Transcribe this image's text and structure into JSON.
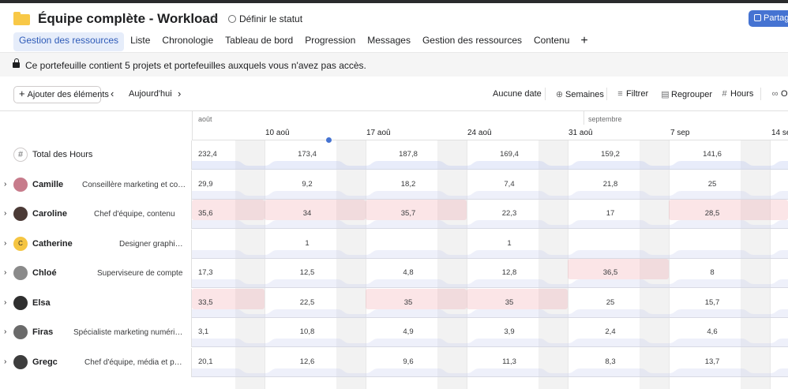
{
  "header": {
    "title": "Équipe complète - Workload",
    "status_label": "Définir le statut",
    "share_label": "Partage"
  },
  "tabs": [
    {
      "label": "Gestion des ressources",
      "active": true
    },
    {
      "label": "Liste"
    },
    {
      "label": "Chronologie"
    },
    {
      "label": "Tableau de bord"
    },
    {
      "label": "Progression"
    },
    {
      "label": "Messages"
    },
    {
      "label": "Gestion des ressources"
    },
    {
      "label": "Contenu"
    }
  ],
  "banner": {
    "text": "Ce portefeuille contient 5 projets et portefeuilles auxquels vous n'avez pas accès."
  },
  "toolbar": {
    "add_label": "Ajouter des éléments",
    "today_label": "Aujourd'hui",
    "no_date_label": "Aucune date",
    "weeks_label": "Semaines",
    "filter_label": "Filtrer",
    "group_label": "Regrouper",
    "hours_label": "Hours",
    "options_label": "Op"
  },
  "timeline": {
    "months": [
      "août",
      "septembre"
    ],
    "weeks": [
      "10 aoû",
      "17 aoû",
      "24 aoû",
      "31 aoû",
      "7 sep",
      "14 se"
    ]
  },
  "total": {
    "label": "Total des Hours",
    "values": [
      "232,4",
      "173,4",
      "187,8",
      "169,4",
      "159,2",
      "141,6"
    ]
  },
  "people": [
    {
      "name": "Camille",
      "role": "Conseillère marketing et com...",
      "values": [
        "29,9",
        "9,2",
        "18,2",
        "7,4",
        "21,8",
        "25"
      ],
      "over": [],
      "avatar_color": "#c77b8b"
    },
    {
      "name": "Caroline",
      "role": "Chef d'équipe, contenu",
      "values": [
        "35,6",
        "34",
        "35,7",
        "22,3",
        "17",
        "28,5"
      ],
      "over": [
        0,
        1,
        2,
        5
      ],
      "avatar_color": "#4b3a36"
    },
    {
      "name": "Catherine",
      "role": "Designer graphiqu...",
      "values": [
        "",
        "1",
        "",
        "1",
        "",
        ""
      ],
      "over": [],
      "avatar_color": "#f5c542",
      "initials": "C"
    },
    {
      "name": "Chloé",
      "role": "Superviseure de compte",
      "values": [
        "17,3",
        "12,5",
        "4,8",
        "12,8",
        "36,5",
        "8"
      ],
      "over": [
        4
      ],
      "avatar_color": "#8a8a8a"
    },
    {
      "name": "Elsa",
      "role": "",
      "values": [
        "33,5",
        "22,5",
        "35",
        "35",
        "25",
        "15,7"
      ],
      "over": [
        0,
        2,
        3
      ],
      "avatar_color": "#2f2f2f"
    },
    {
      "name": "Firas",
      "role": "Spécialiste marketing numériqu...",
      "values": [
        "3,1",
        "10,8",
        "4,9",
        "3,9",
        "2,4",
        "4,6"
      ],
      "over": [],
      "avatar_color": "#6a6a6a"
    },
    {
      "name": "Gregc",
      "role": "Chef d'équipe, média et perf...",
      "values": [
        "20,1",
        "12,6",
        "9,6",
        "11,3",
        "8,3",
        "13,7"
      ],
      "over": [],
      "avatar_color": "#3d3d3d"
    }
  ],
  "colors": {
    "accent": "#4573d2",
    "folder": "#f8c847",
    "over_capacity": "#f0a0aa"
  }
}
